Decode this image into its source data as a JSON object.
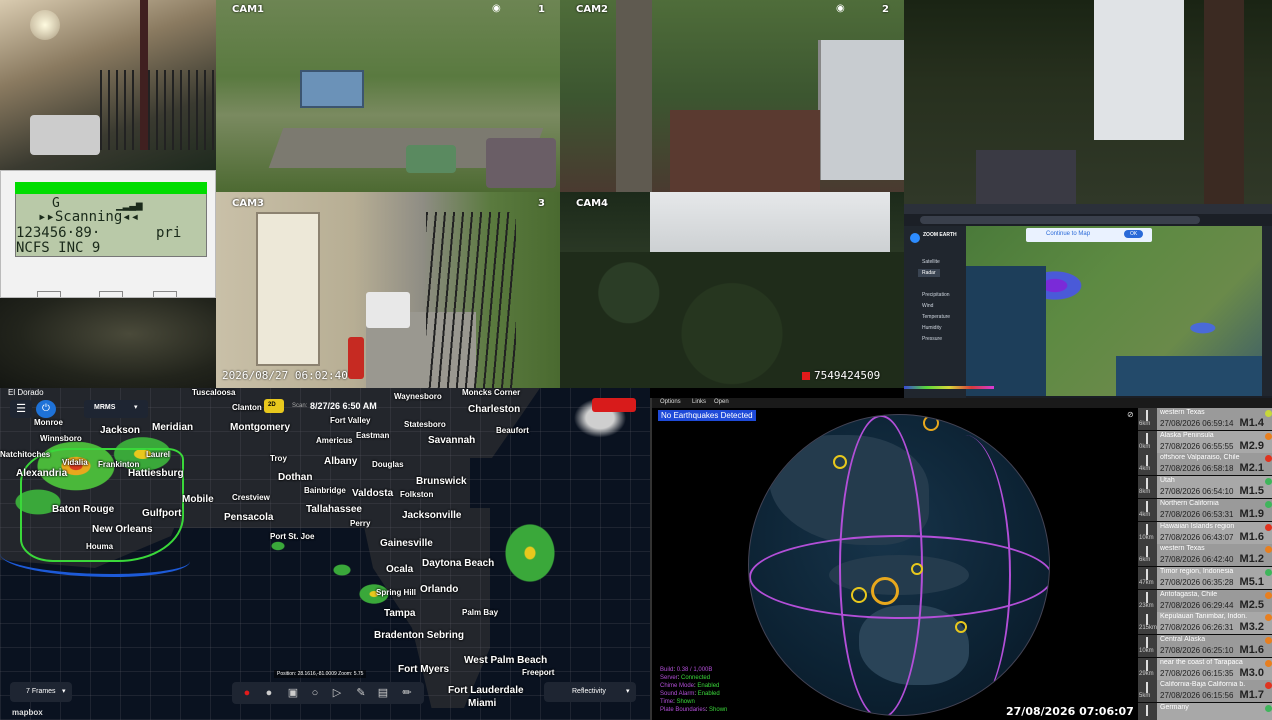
{
  "cameras": [
    {
      "id": "cam1",
      "label": "CAM1",
      "index": "1"
    },
    {
      "id": "cam2",
      "label": "CAM2",
      "index": "2"
    },
    {
      "id": "cam3",
      "label": "CAM3",
      "index": "3",
      "timestamp": "2026/08/27  06:02:40"
    },
    {
      "id": "cam4",
      "label": "CAM4",
      "counter": "7549424509"
    }
  ],
  "scanner": {
    "signal": "G",
    "status": "▸▸Scanning◂◂",
    "frequency": "123456·89·",
    "mode": "pri",
    "system": "NCFS INC 9"
  },
  "weather_map": {
    "brand": "ZOOM EARTH",
    "menu": [
      "Satellite",
      "Radar",
      "Precipitation",
      "Wind",
      "Temperature",
      "Humidity",
      "Pressure"
    ],
    "banner": "Continue to Map",
    "banner_button": "OK"
  },
  "radar": {
    "location_tag": "El Dorado",
    "product": "MRMS",
    "badge": "2D",
    "scan_label": "Scan:",
    "scan_time": "8/27/26 6:50 AM",
    "frames": "7 Frames",
    "layer": "Reflectivity",
    "position": "Position: 28.1616,-81.0009  Zoom: 5.75",
    "attribution": "mapbox",
    "cities": [
      {
        "name": "Montgomery"
      },
      {
        "name": "Savannah"
      },
      {
        "name": "Charleston"
      },
      {
        "name": "Tallahassee"
      },
      {
        "name": "Jacksonville"
      },
      {
        "name": "Gainesville"
      },
      {
        "name": "Orlando"
      },
      {
        "name": "Tampa"
      },
      {
        "name": "Baton Rouge"
      },
      {
        "name": "New Orleans"
      },
      {
        "name": "Mobile"
      },
      {
        "name": "Dothan"
      },
      {
        "name": "Albany"
      },
      {
        "name": "Valdosta"
      },
      {
        "name": "Pensacola"
      },
      {
        "name": "Daytona Beach"
      },
      {
        "name": "Fort Myers"
      },
      {
        "name": "Fort Lauderdale"
      },
      {
        "name": "West Palm Beach"
      },
      {
        "name": "Miami"
      },
      {
        "name": "Gulfport"
      },
      {
        "name": "Meridian"
      },
      {
        "name": "Jackson"
      },
      {
        "name": "Hattiesburg"
      },
      {
        "name": "Alexandria"
      },
      {
        "name": "Brunswick"
      },
      {
        "name": "Ocala"
      },
      {
        "name": "Bradenton Sebring"
      },
      {
        "name": "Statesboro"
      },
      {
        "name": "Waynesboro"
      },
      {
        "name": "Fort Valley"
      },
      {
        "name": "Americus"
      },
      {
        "name": "Eastman"
      },
      {
        "name": "Douglas"
      },
      {
        "name": "Bainbridge"
      },
      {
        "name": "Crestview"
      },
      {
        "name": "Perry"
      },
      {
        "name": "Folkston"
      },
      {
        "name": "Spring Hill"
      },
      {
        "name": "Palm Bay"
      },
      {
        "name": "Freeport"
      },
      {
        "name": "Clanton"
      },
      {
        "name": "Troy"
      },
      {
        "name": "Houma"
      },
      {
        "name": "Port St. Joe"
      },
      {
        "name": "Monroe"
      },
      {
        "name": "Winnsboro"
      },
      {
        "name": "Laurel"
      },
      {
        "name": "Frankinton"
      },
      {
        "name": "Vidalia"
      },
      {
        "name": "Natchitoches"
      },
      {
        "name": "Moncks Corner"
      },
      {
        "name": "Tuscaloosa"
      },
      {
        "name": "Beaufort"
      }
    ]
  },
  "earthquake": {
    "menu": [
      "Options",
      "Links",
      "Open"
    ],
    "status": "No Earthquakes Detected",
    "clock": "27/08/2026 07:06:07",
    "stats": [
      {
        "label": "Build",
        "value": "0.38 / 1,000B"
      },
      {
        "label": "Server",
        "value": "Connected"
      },
      {
        "label": "Chime Mode",
        "value": "Enabled"
      },
      {
        "label": "Sound Alarm",
        "value": "Enabled"
      },
      {
        "label": "Time",
        "value": "Shown"
      },
      {
        "label": "Plate Boundaries",
        "value": "Shown"
      }
    ],
    "feed": [
      {
        "location": "western Texas",
        "time": "27/08/2026 06:59:14",
        "mag": "M1.4",
        "depth": "6km",
        "color": "#c7d83a"
      },
      {
        "location": "Alaska Peninsula",
        "time": "27/08/2026 06:55:55",
        "mag": "M2.9",
        "depth": "0km",
        "color": "#e87f1f"
      },
      {
        "location": "offshore Valparaiso, Chile",
        "time": "27/08/2026 06:58:18",
        "mag": "M2.1",
        "depth": "4km",
        "color": "#e0331f"
      },
      {
        "location": "Utah",
        "time": "27/08/2026 06:54:10",
        "mag": "M1.5",
        "depth": "8km",
        "color": "#3fb55b"
      },
      {
        "location": "Northern California",
        "time": "27/08/2026 06:53:31",
        "mag": "M1.9",
        "depth": "4km",
        "color": "#3fb55b"
      },
      {
        "location": "Hawaiian Islands region",
        "time": "27/08/2026 06:43:07",
        "mag": "M1.6",
        "depth": "10km",
        "color": "#e0331f"
      },
      {
        "location": "western Texas",
        "time": "27/08/2026 06:42:40",
        "mag": "M1.2",
        "depth": "6km",
        "color": "#e87f1f"
      },
      {
        "location": "Timor region, Indonesia",
        "time": "27/08/2026 06:35:28",
        "mag": "M5.1",
        "depth": "47km",
        "color": "#3fb55b"
      },
      {
        "location": "Antofagasta, Chile",
        "time": "27/08/2026 06:29:44",
        "mag": "M2.5",
        "depth": "23km",
        "color": "#e87f1f"
      },
      {
        "location": "Kepulauan Tanimbar, Indon.",
        "time": "27/08/2026 06:26:31",
        "mag": "M3.2",
        "depth": "215km",
        "color": "#e87f1f"
      },
      {
        "location": "Central Alaska",
        "time": "27/08/2026 06:25:10",
        "mag": "M1.6",
        "depth": "10km",
        "color": "#e87f1f"
      },
      {
        "location": "near the coast of Tarapaca",
        "time": "27/08/2026 06:15:35",
        "mag": "M3.0",
        "depth": "29km",
        "color": "#e87f1f"
      },
      {
        "location": "California-Baja California b.",
        "time": "27/08/2026 06:15:56",
        "mag": "M1.7",
        "depth": "5km",
        "color": "#e0331f"
      },
      {
        "location": "Germany",
        "time": "",
        "mag": "",
        "depth": "",
        "color": "#3fb55b"
      }
    ]
  },
  "colors": {
    "accent": "#1e72d8",
    "scanner_green": "#00dd00",
    "radar_water": "#0a1220",
    "globe_ocean": "#0c2233",
    "land": "#243b4d",
    "plate_line": "#b34fd8"
  }
}
